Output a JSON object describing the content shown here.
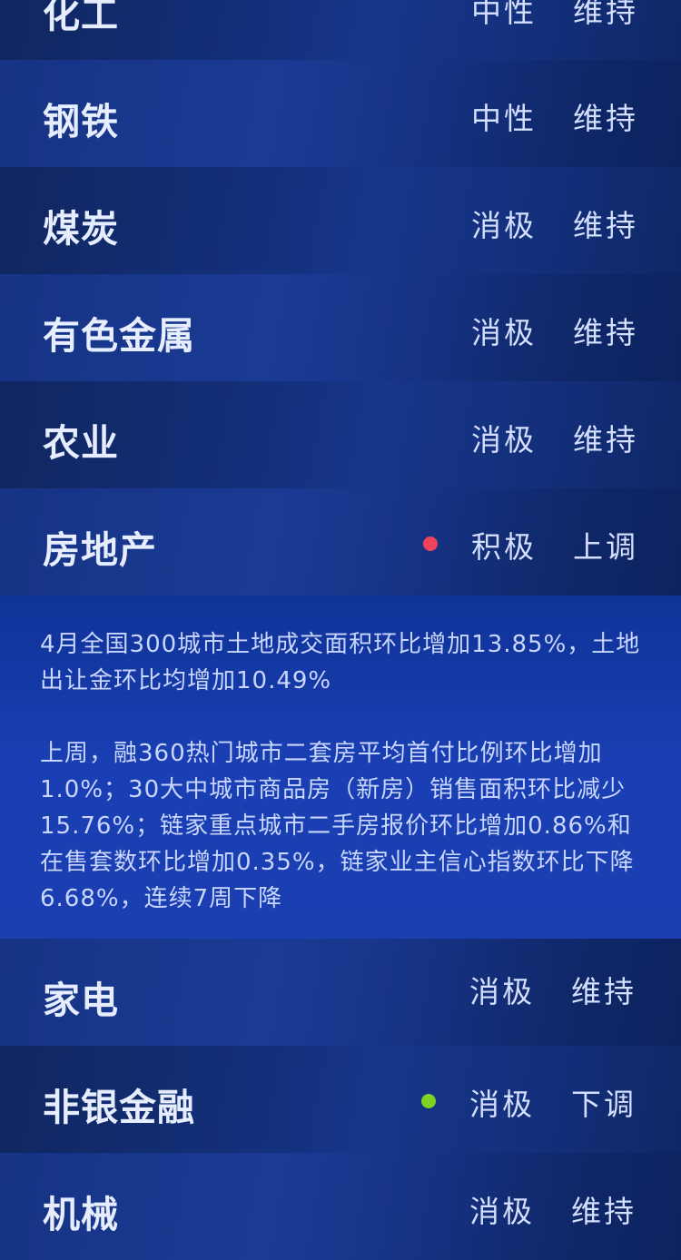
{
  "sectors_top": [
    {
      "name": "化工",
      "view": "中性",
      "change": "维持",
      "dot": null
    },
    {
      "name": "钢铁",
      "view": "中性",
      "change": "维持",
      "dot": null
    },
    {
      "name": "煤炭",
      "view": "消极",
      "change": "维持",
      "dot": null
    },
    {
      "name": "有色金属",
      "view": "消极",
      "change": "维持",
      "dot": null
    },
    {
      "name": "农业",
      "view": "消极",
      "change": "维持",
      "dot": null
    },
    {
      "name": "房地产",
      "view": "积极",
      "change": "上调",
      "dot": "#f0435a"
    }
  ],
  "detail": {
    "paragraph_1": "4月全国300城市土地成交面积环比增加13.85%，土地出让金环比均增加10.49%",
    "paragraph_2": "上周，融360热门城市二套房平均首付比例环比增加1.0%；30大中城市商品房（新房）销售面积环比减少15.76%；链家重点城市二手房报价环比增加0.86%和在售套数环比增加0.35%，链家业主信心指数环比下降6.68%，连续7周下降"
  },
  "sectors_bottom": [
    {
      "name": "家电",
      "view": "消极",
      "change": "维持",
      "dot": null
    },
    {
      "name": "非银金融",
      "view": "消极",
      "change": "下调",
      "dot": "#7ed321"
    },
    {
      "name": "机械",
      "view": "消极",
      "change": "维持",
      "dot": null
    }
  ]
}
